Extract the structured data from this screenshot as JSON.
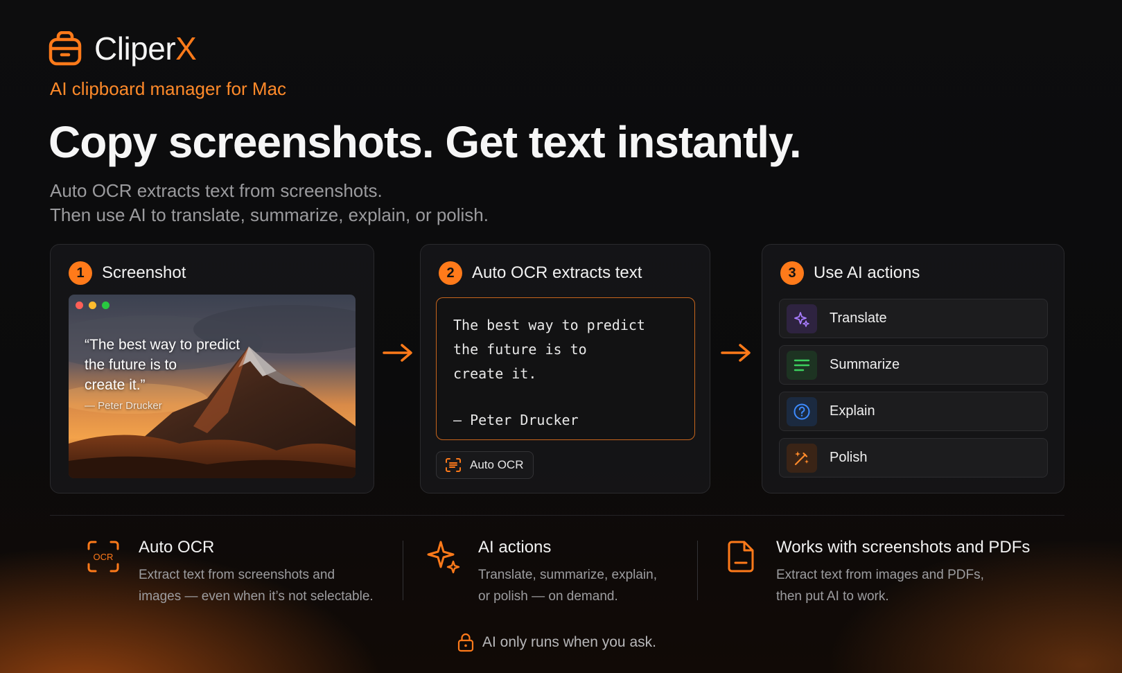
{
  "brand": {
    "name_prefix": "Cliper",
    "name_suffix": "X",
    "tagline": "AI clipboard manager for Mac"
  },
  "hero": {
    "headline": "Copy screenshots. Get text instantly.",
    "sub_line_1": "Auto OCR extracts text from screenshots.",
    "sub_line_2": "Then use AI to translate, summarize, explain, or polish."
  },
  "steps": [
    {
      "number": "1",
      "title": "Screenshot",
      "quote_lines": [
        "“The best way to predict",
        "the future is to",
        "create it.”"
      ],
      "author": "— Peter Drucker"
    },
    {
      "number": "2",
      "title": "Auto OCR extracts text",
      "ocr_lines": [
        "The best way to predict",
        "the future is to",
        "create it."
      ],
      "ocr_author": "— Peter Drucker",
      "badge_label": "Auto OCR"
    },
    {
      "number": "3",
      "title": "Use AI actions",
      "actions": [
        {
          "label": "Translate",
          "icon": "sparkle-icon"
        },
        {
          "label": "Summarize",
          "icon": "lines-icon"
        },
        {
          "label": "Explain",
          "icon": "question-icon"
        },
        {
          "label": "Polish",
          "icon": "wand-icon"
        }
      ]
    }
  ],
  "features": [
    {
      "title": "Auto OCR",
      "desc_line_1": "Extract text from screenshots and",
      "desc_line_2": "images — even when it’s not selectable.",
      "icon": "ocr-scan-icon"
    },
    {
      "title": "AI actions",
      "desc_line_1": "Translate, summarize, explain,",
      "desc_line_2": "or polish — on demand.",
      "icon": "sparkle-icon"
    },
    {
      "title": "Works with screenshots and PDFs",
      "desc_line_1": "Extract text from images and PDFs,",
      "desc_line_2": "then put AI to work.",
      "icon": "document-icon"
    }
  ],
  "footer": {
    "note": "AI only runs when you ask.",
    "icon": "lock-icon"
  },
  "colors": {
    "accent": "#ff7a1a",
    "translate_icon_bg": "#2e2340",
    "translate_icon": "#a87cff",
    "summarize_icon_bg": "#1d3322",
    "summarize_icon": "#3ccf5e",
    "explain_icon_bg": "#1b2a40",
    "explain_icon": "#3d8bff",
    "polish_icon_bg": "#3a2416",
    "polish_icon": "#ff8a2a"
  }
}
